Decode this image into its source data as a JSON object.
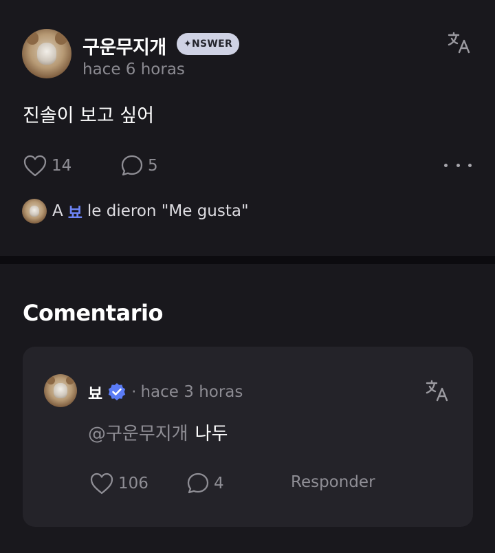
{
  "post": {
    "username": "구운무지개",
    "badge": "✦NSWER",
    "timestamp": "hace 6 horas",
    "text": "진솔이 보고 싶어",
    "likes": "14",
    "comments": "5",
    "liked_by": {
      "prefix": "A",
      "name": "뵤",
      "suffix": "le dieron \"Me gusta\""
    }
  },
  "comments_section": {
    "title": "Comentario",
    "comment": {
      "username": "뵤",
      "separator": "·",
      "timestamp": "hace 3 horas",
      "mention": "@구운무지개",
      "text": "나두",
      "likes": "106",
      "replies": "4",
      "reply_label": "Responder"
    }
  },
  "icons": {
    "translate": "translate-icon",
    "like": "heart-icon",
    "comment": "speech-bubble-icon",
    "more": "more-options-icon",
    "verified": "verified-badge-icon"
  },
  "colors": {
    "background": "#19181d",
    "card": "#242329",
    "accent": "#6d84f5",
    "verified": "#5b7cf6",
    "badge_bg": "#cfd2e4"
  }
}
